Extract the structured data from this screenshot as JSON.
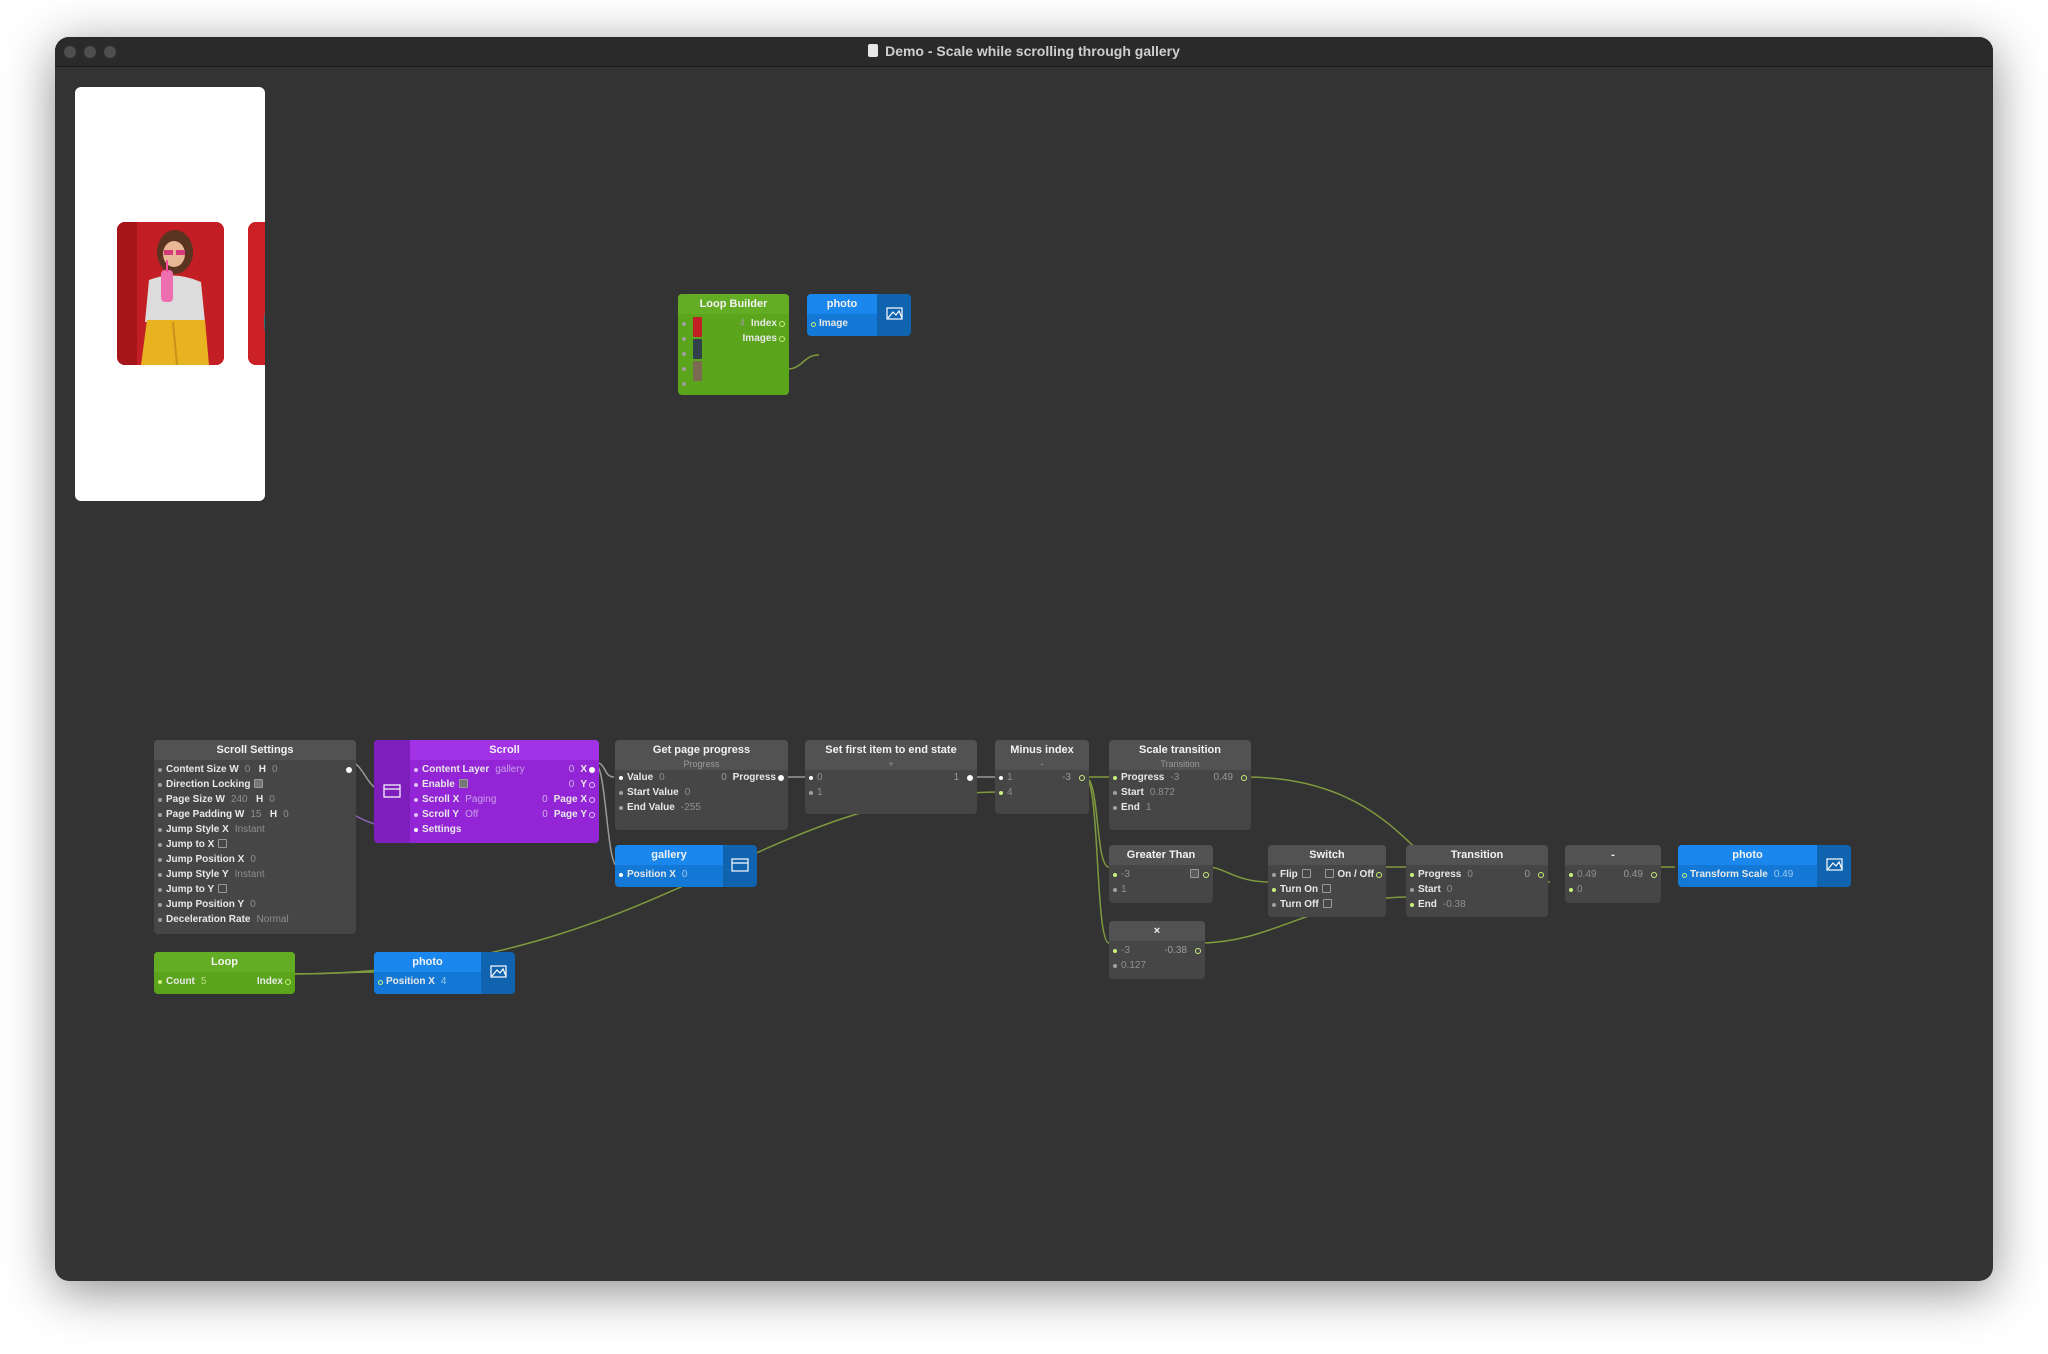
{
  "window": {
    "title": "Demo - Scale while scrolling through gallery"
  },
  "icons": {
    "document": "document-icon",
    "layer_image": "image-layer-icon",
    "layer_group": "group-layer-icon"
  },
  "colors": {
    "canvas": "#333333",
    "node_gray": "#464646",
    "node_green": "#5aa51b",
    "node_purple": "#9325d6",
    "node_blue": "#1479d6",
    "wire": "#7f9a3e"
  },
  "nodes": {
    "loop_builder": {
      "title": "Loop Builder",
      "index_value": "4",
      "index_label": "Index",
      "images_label": "Images"
    },
    "photo_top": {
      "title": "photo",
      "image_label": "Image"
    },
    "scroll_settings": {
      "title": "Scroll Settings",
      "rows": [
        {
          "label": "Content Size",
          "w": "W",
          "wv": "0",
          "h": "H",
          "hv": "0"
        },
        {
          "label": "Direction Locking"
        },
        {
          "label": "Page Size",
          "w": "W",
          "wv": "240",
          "h": "H",
          "hv": "0"
        },
        {
          "label": "Page Padding",
          "w": "W",
          "wv": "15",
          "h": "H",
          "hv": "0"
        },
        {
          "label": "Jump Style X",
          "v": "Instant"
        },
        {
          "label": "Jump to X"
        },
        {
          "label": "Jump Position X",
          "v": "0"
        },
        {
          "label": "Jump Style Y",
          "v": "Instant"
        },
        {
          "label": "Jump to Y"
        },
        {
          "label": "Jump Position Y",
          "v": "0"
        },
        {
          "label": "Deceleration Rate",
          "v": "Normal"
        }
      ]
    },
    "scroll": {
      "title": "Scroll",
      "rows": [
        {
          "label": "Content Layer",
          "v": "gallery",
          "ov": "0",
          "out": "X"
        },
        {
          "label": "Enable",
          "ov": "0",
          "out": "Y"
        },
        {
          "label": "Scroll X",
          "v": "Paging",
          "ov": "0",
          "out": "Page X"
        },
        {
          "label": "Scroll Y",
          "v": "Off",
          "ov": "0",
          "out": "Page Y"
        },
        {
          "label": "Settings"
        }
      ]
    },
    "get_page_progress": {
      "title": "Get page progress",
      "subtitle": "Progress",
      "rows": [
        {
          "label": "Value",
          "v": "0",
          "ov": "0",
          "out": "Progress"
        },
        {
          "label": "Start Value",
          "v": "0"
        },
        {
          "label": "End Value",
          "v": "-255"
        }
      ]
    },
    "gallery": {
      "title": "gallery",
      "port": "Position X",
      "v": "0"
    },
    "set_first_item": {
      "title": "Set first item to end state",
      "subtitle": "+",
      "in1": "0",
      "out1": "1",
      "in2": "1"
    },
    "minus_index": {
      "title": "Minus index",
      "subtitle": "-",
      "in1": "1",
      "out1": "-3",
      "in2": "4"
    },
    "scale_transition": {
      "title": "Scale transition",
      "subtitle": "Transition",
      "rows": [
        {
          "label": "Progress",
          "v": "-3",
          "ov": "0.49"
        },
        {
          "label": "Start",
          "v": "0.872"
        },
        {
          "label": "End",
          "v": "1"
        }
      ]
    },
    "greater_than": {
      "title": "Greater Than",
      "in1": "-3",
      "in2": "1"
    },
    "multiply": {
      "title": "×",
      "in1": "-3",
      "out": "-0.38",
      "in2": "0.127"
    },
    "switch": {
      "title": "Switch",
      "flip": "Flip",
      "out": "On / Off",
      "turn_on": "Turn On",
      "turn_off": "Turn Off"
    },
    "transition": {
      "title": "Transition",
      "rows": [
        {
          "label": "Progress",
          "v": "0",
          "ov": "0"
        },
        {
          "label": "Start",
          "v": "0"
        },
        {
          "label": "End",
          "v": "-0.38"
        }
      ]
    },
    "minus": {
      "title": "-",
      "in1": "0.49",
      "out": "0.49",
      "in2": "0"
    },
    "photo_scale": {
      "title": "photo",
      "port": "Transform Scale",
      "v": "0.49"
    },
    "loop": {
      "title": "Loop",
      "count_label": "Count",
      "count": "5",
      "out": "Index"
    },
    "photo_pos": {
      "title": "photo",
      "port": "Position X",
      "v": "4"
    }
  }
}
